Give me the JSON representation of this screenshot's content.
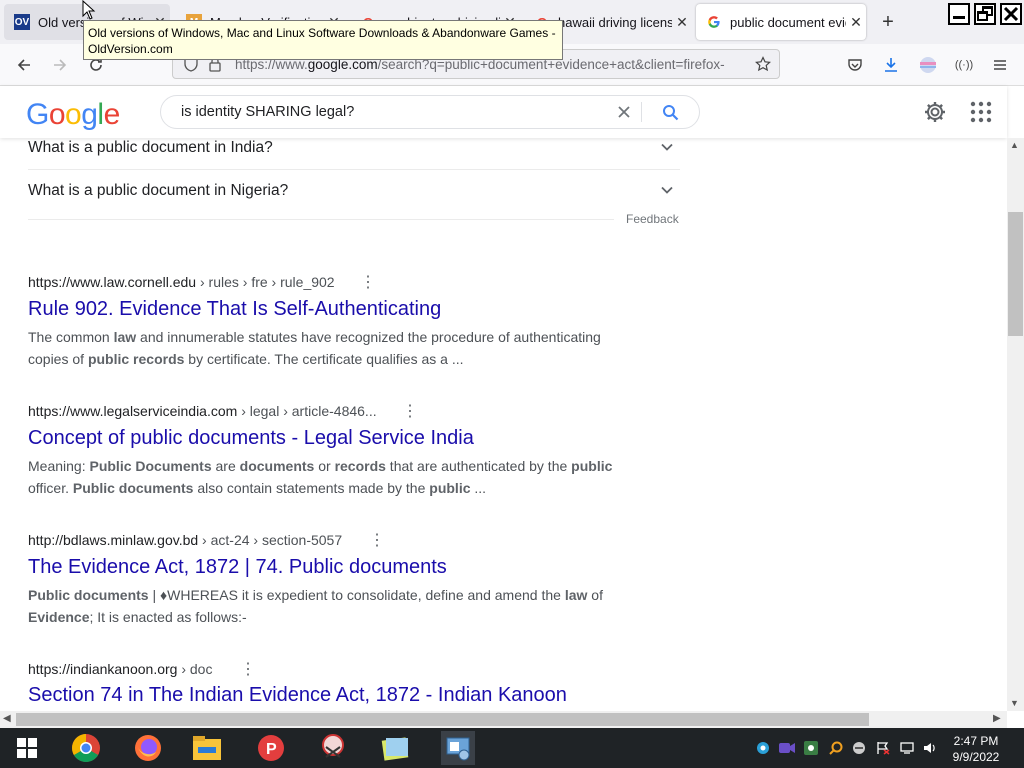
{
  "browser": {
    "tabs": [
      {
        "label": "Old versions of Windows",
        "favicon": "oldversion-favicon"
      },
      {
        "label": "Member Verification",
        "favicon": "member-favicon"
      },
      {
        "label": "washington driving license",
        "favicon": "google-favicon"
      },
      {
        "label": "hawaii driving license",
        "favicon": "google-favicon"
      },
      {
        "label": "public document evidence",
        "favicon": "google-favicon"
      }
    ],
    "new_tab_label": "+",
    "url": "https://www.google.com/search?q=public+document+evidence+act&client=firefox-b-d",
    "url_prefix": "https://www.",
    "url_domain": "google.com",
    "url_rest": "/search?q=public+document+evidence+act&client=firefox-",
    "tooltip": "Old versions of Windows, Mac and Linux Software Downloads & Abandonware Games - OldVersion.com"
  },
  "google": {
    "logo": "Google",
    "search_query": "is identity SHARING legal?"
  },
  "paa": [
    {
      "question": "What is a public document in India?"
    },
    {
      "question": "What is a public document in Nigeria?"
    }
  ],
  "feedback_label": "Feedback",
  "results": [
    {
      "domain": "https://www.law.cornell.edu",
      "crumbs": " › rules › fre › rule_902",
      "title": "Rule 902. Evidence That Is Self-Authenticating",
      "snippet_html": "The common <b>law</b> and innumerable statutes have recognized the procedure of authenticating copies of <b>public records</b> by certificate. The certificate qualifies as a ..."
    },
    {
      "domain": "https://www.legalserviceindia.com",
      "crumbs": " › legal › article-4846...",
      "title": "Concept of public documents - Legal Service India",
      "snippet_html": "Meaning: <b>Public Documents</b> are <b>documents</b> or <b>records</b> that are authenticated by the <b>public</b> officer. <b>Public documents</b> also contain statements made by the <b>public</b> ..."
    },
    {
      "domain": "http://bdlaws.minlaw.gov.bd",
      "crumbs": " › act-24 › section-5057",
      "title": "The Evidence Act, 1872 | 74. Public documents",
      "snippet_html": "<b>Public documents</b> | ♦WHEREAS it is expedient to consolidate, define and amend the <b>law</b> of <b>Evidence</b>; It is enacted as follows:-"
    },
    {
      "domain": "https://indiankanoon.org",
      "crumbs": " › doc",
      "title": "Section 74 in The Indian Evidence Act, 1872 - Indian Kanoon",
      "snippet_html": ""
    }
  ],
  "taskbar": {
    "time": "2:47 PM",
    "date": "9/9/2022"
  },
  "colors": {
    "link": "#1a0dab",
    "google_blue": "#4285f4",
    "google_red": "#ea4335",
    "google_yellow": "#fbbc05",
    "google_green": "#34a853"
  }
}
